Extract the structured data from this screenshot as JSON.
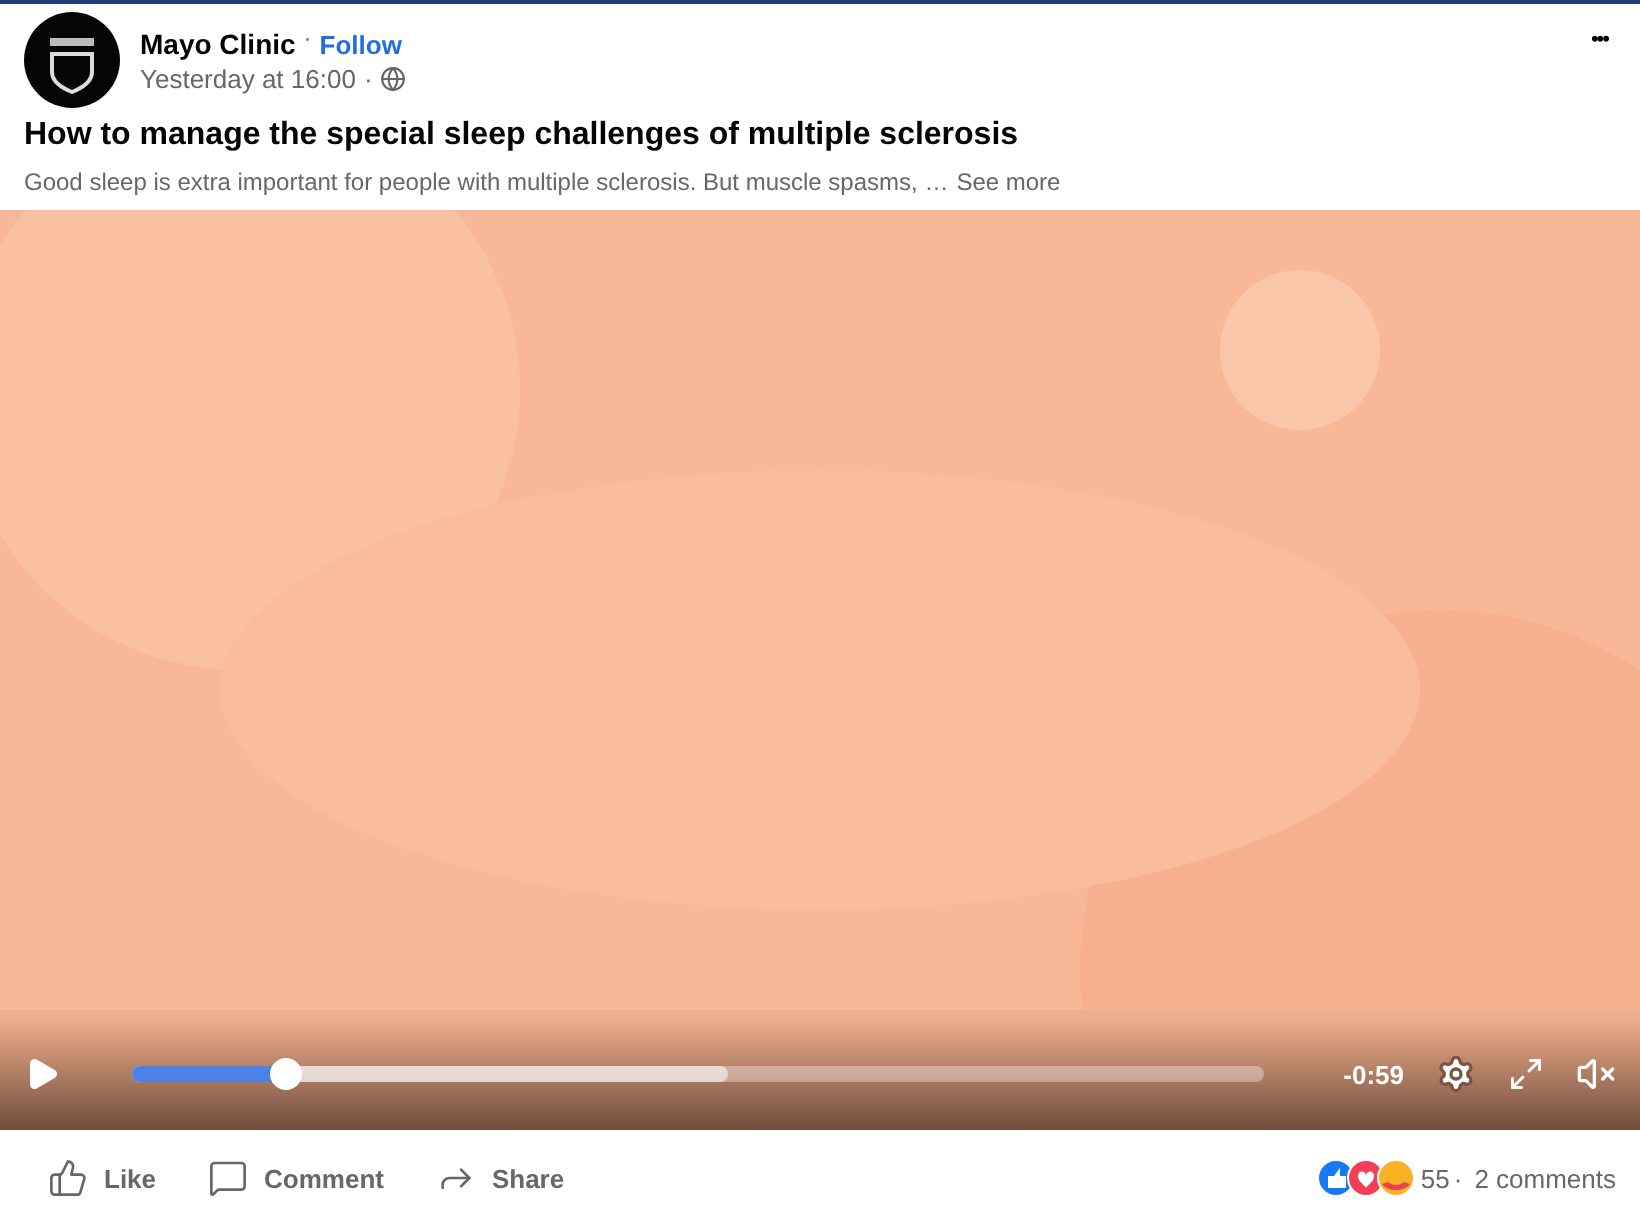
{
  "post": {
    "author": "Mayo Clinic",
    "separator": "·",
    "follow": "Follow",
    "time": "Yesterday at 16:00",
    "time_separator": "·",
    "title": "How to manage the special sleep challenges of multiple sclerosis",
    "excerpt": "Good sleep is extra important for people with multiple sclerosis. But muscle spasms, …",
    "see_more": "See more",
    "menu": "•••"
  },
  "video": {
    "kind": "picture",
    "playing": false,
    "muted": true,
    "progress": {
      "level": 0.137
    },
    "buffered": {
      "level": 0.526
    },
    "remaining": "-0:59"
  },
  "actions": [
    {
      "kind": "like",
      "label": "Like"
    },
    {
      "kind": "comment",
      "label": "Comment"
    },
    {
      "kind": "share",
      "label": "Share"
    }
  ],
  "reactions": {
    "count": "55",
    "separator": "·",
    "comments": "2 comments"
  }
}
